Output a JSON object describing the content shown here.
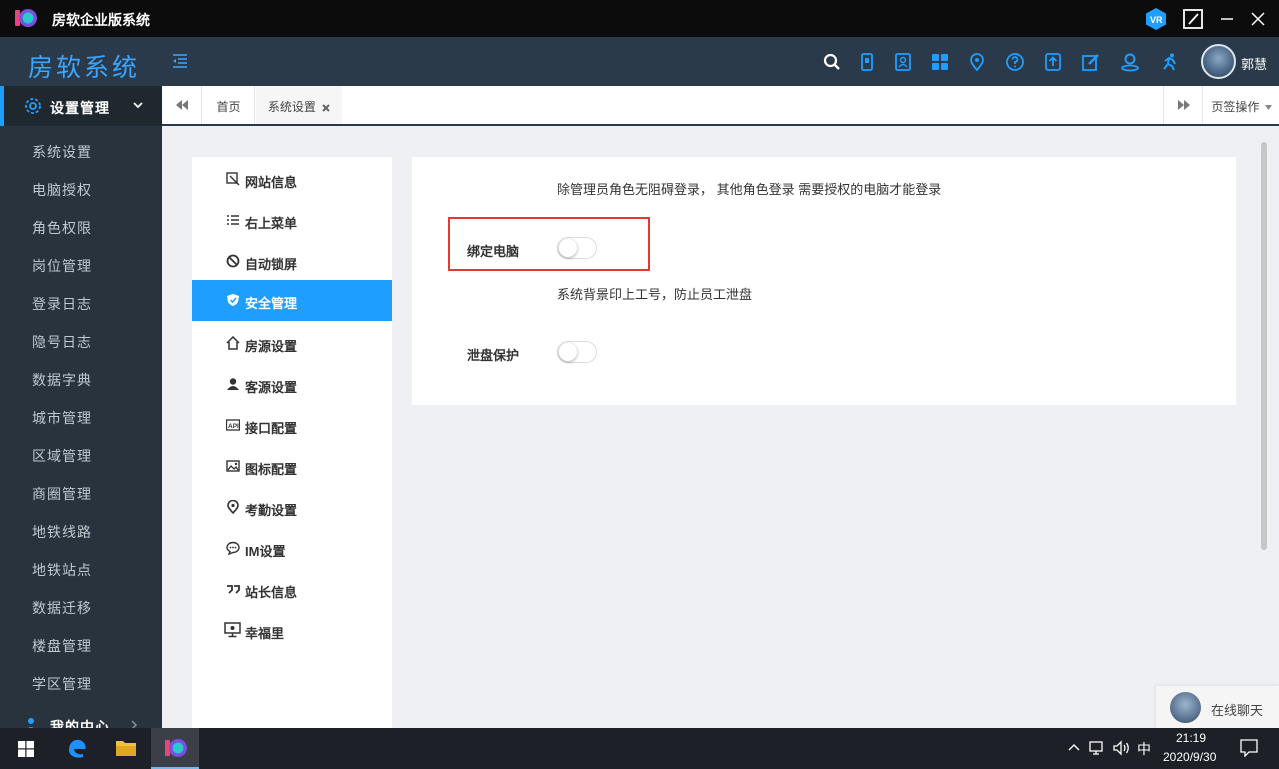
{
  "titlebar": {
    "title": "房软企业版系统",
    "icons": [
      "app-logo-icon",
      "vr-icon",
      "edit-window-icon",
      "minimize-icon",
      "close-icon"
    ]
  },
  "header": {
    "brand": "房软系统",
    "user_name": "郭慧",
    "icons": [
      "search-icon",
      "mobile-icon",
      "contact-card-icon",
      "grid-icon",
      "location-pin-icon",
      "help-icon",
      "upload-icon",
      "edit-icon",
      "user-location-icon",
      "run-icon"
    ]
  },
  "sidebar": {
    "group_label": "设置管理",
    "items": [
      {
        "label": "系统设置"
      },
      {
        "label": "电脑授权"
      },
      {
        "label": "角色权限"
      },
      {
        "label": "岗位管理"
      },
      {
        "label": "登录日志"
      },
      {
        "label": "隐号日志"
      },
      {
        "label": "数据字典"
      },
      {
        "label": "城市管理"
      },
      {
        "label": "区域管理"
      },
      {
        "label": "商圈管理"
      },
      {
        "label": "地铁线路"
      },
      {
        "label": "地铁站点"
      },
      {
        "label": "数据迁移"
      },
      {
        "label": "楼盘管理"
      },
      {
        "label": "学区管理"
      }
    ],
    "next_group_label": "我的中心"
  },
  "tabbar": {
    "tabs": [
      {
        "label": "首页",
        "active": false
      },
      {
        "label": "系统设置",
        "active": true,
        "closable": true
      }
    ],
    "page_actions_label": "页签操作"
  },
  "settings_menu": {
    "items": [
      {
        "label": "网站信息",
        "icon": "website-info-icon"
      },
      {
        "label": "右上菜单",
        "icon": "list-icon"
      },
      {
        "label": "自动锁屏",
        "icon": "ban-icon"
      },
      {
        "label": "安全管理",
        "icon": "shield-icon",
        "active": true
      },
      {
        "label": "房源设置",
        "icon": "home-icon"
      },
      {
        "label": "客源设置",
        "icon": "user-icon"
      },
      {
        "label": "接口配置",
        "icon": "api-icon"
      },
      {
        "label": "图标配置",
        "icon": "image-icon"
      },
      {
        "label": "考勤设置",
        "icon": "location-icon"
      },
      {
        "label": "IM设置",
        "icon": "chat-icon"
      },
      {
        "label": "站长信息",
        "icon": "quote-icon"
      },
      {
        "label": "幸福里",
        "icon": "monitor-icon"
      }
    ]
  },
  "security": {
    "bind_desc": "除管理员角色无阻碍登录， 其他角色登录 需要授权的电脑才能登录",
    "bind_label": "绑定电脑",
    "bind_on": false,
    "leak_desc": "系统背景印上工号，防止员工泄盘",
    "leak_label": "泄盘保护",
    "leak_on": false
  },
  "chat": {
    "label": "在线聊天"
  },
  "taskbar": {
    "ime": "中",
    "time": "21:19",
    "date": "2020/9/30"
  },
  "colors": {
    "accent": "#1e9fff",
    "sidebar": "#28333e",
    "header": "#2b3a4a",
    "highlight": "#e53935"
  }
}
